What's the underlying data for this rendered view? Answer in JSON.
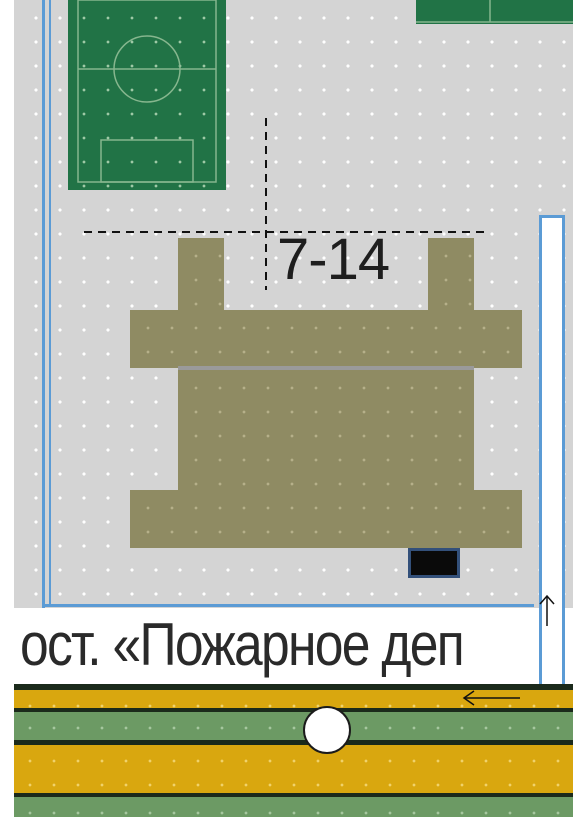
{
  "map": {
    "building_label": "7-14",
    "stop_name": "ост. «Пожарное деп",
    "icons": [
      "football-field",
      "bus-stop-marker",
      "arrow-up-icon",
      "arrow-left-icon"
    ],
    "colors": {
      "ground": "#d4d4d4",
      "field": "#217346",
      "building": "#8f8b63",
      "boundary": "#5b9bd5",
      "lane_yellow": "#d9a70f",
      "lane_green": "#6c9a64"
    }
  }
}
